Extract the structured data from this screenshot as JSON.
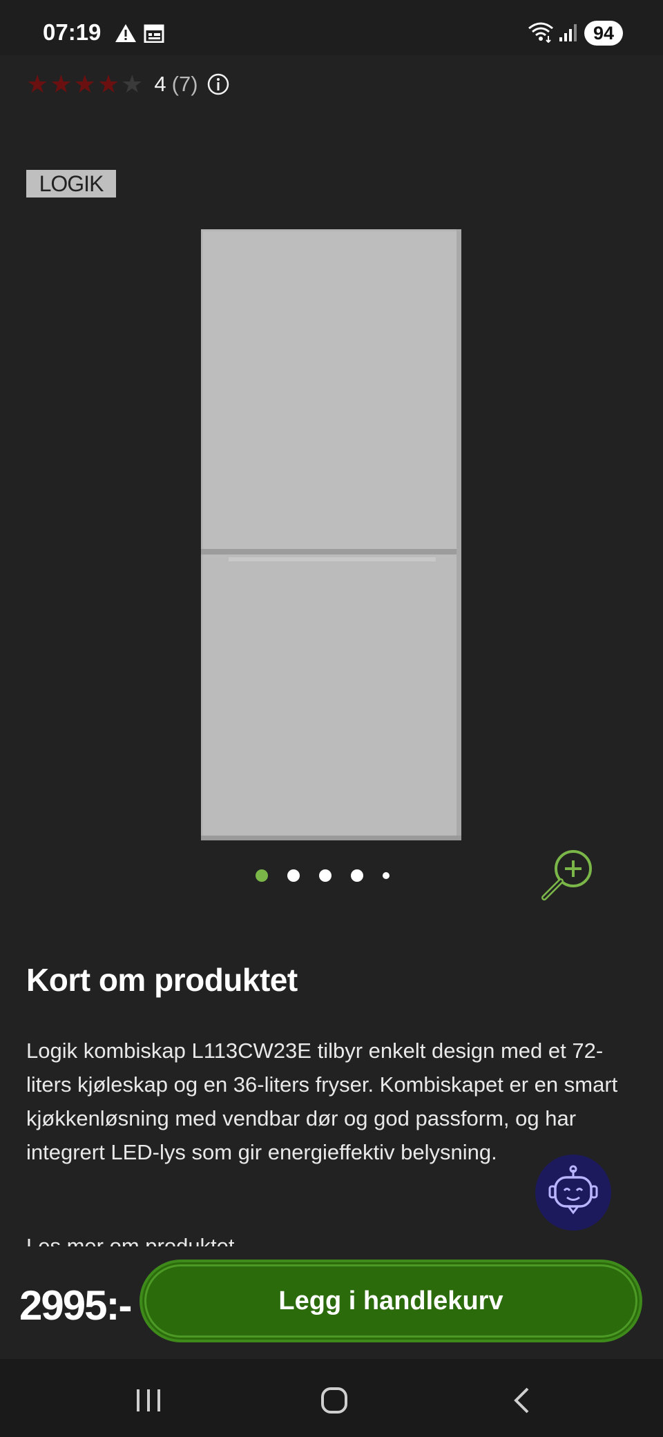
{
  "status_bar": {
    "time": "07:19",
    "battery": "94",
    "icons": [
      "warning-icon",
      "calendar-icon",
      "wifi-icon",
      "signal-icon"
    ]
  },
  "rating": {
    "stars_filled": 4,
    "stars_total": 5,
    "value": "4",
    "count": "(7)",
    "star_color": "#6b1010"
  },
  "brand": {
    "logo_text": "LOGIK"
  },
  "gallery": {
    "slide_count": 5,
    "active_index": 0,
    "active_color": "#7ab648"
  },
  "product": {
    "section_title": "Kort om produktet",
    "description": "Logik kombiskap L113CW23E tilbyr enkelt design med et 72-liters kjøleskap og en 36-liters fryser. Kombiskapet er en smart kjøkkenløsning med vendbar dør og god passform, og har integrert LED-lys som gir energieffektiv belysning.",
    "read_more": "Les mer om produktet"
  },
  "purchase": {
    "price": "2995:-",
    "cart_button": "Legg i handlekurv",
    "button_color": "#2b6b0c"
  },
  "nav": {
    "icons": [
      "recent-apps-icon",
      "home-icon",
      "back-icon"
    ]
  }
}
